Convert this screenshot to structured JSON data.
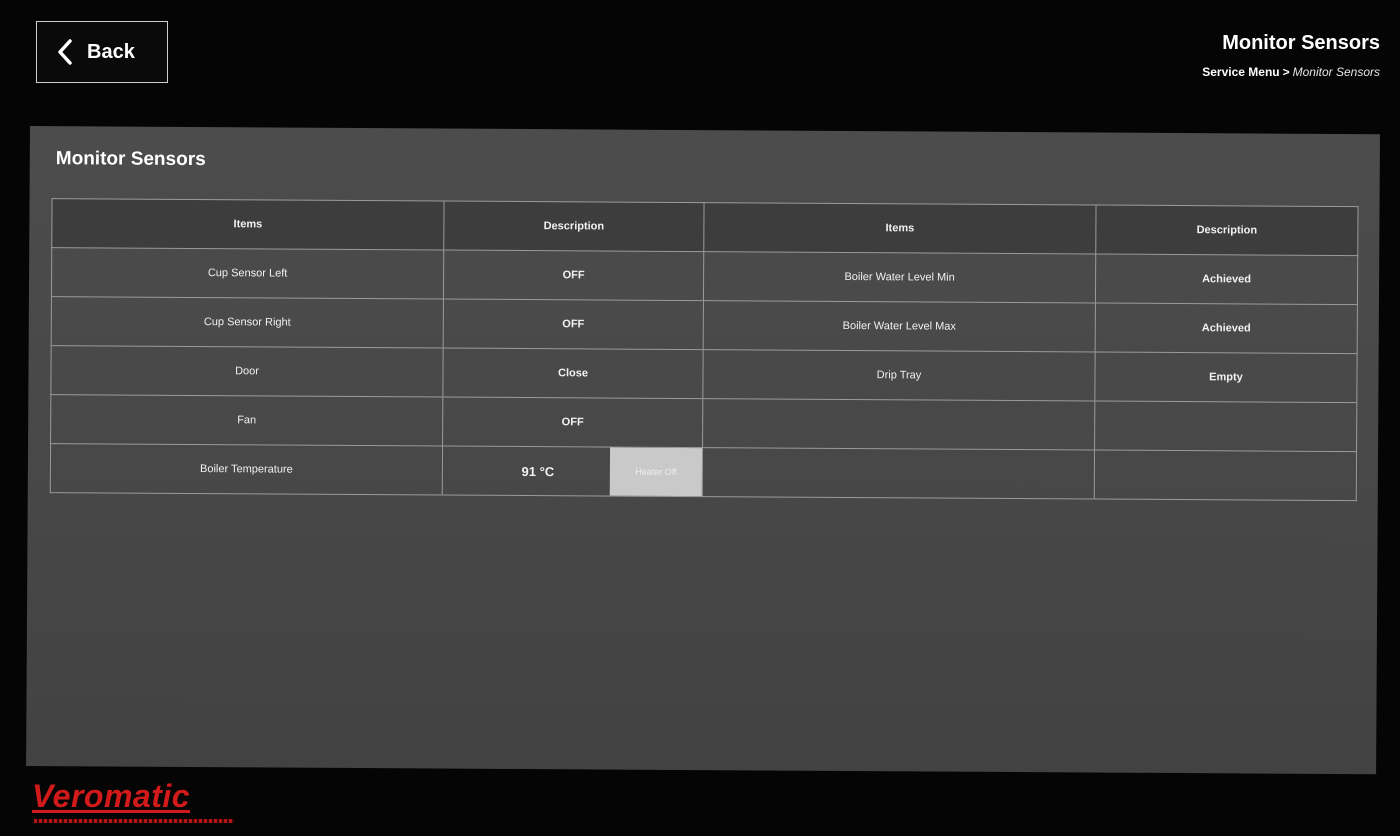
{
  "header": {
    "back_label": "Back",
    "title": "Monitor Sensors",
    "breadcrumb": {
      "parent": "Service Menu",
      "separator": ">",
      "current": "Monitor Sensors"
    }
  },
  "panel": {
    "title": "Monitor Sensors",
    "columns": [
      "Items",
      "Description",
      "Items",
      "Description"
    ],
    "left_rows": [
      {
        "item": "Cup Sensor Left",
        "value": "OFF"
      },
      {
        "item": "Cup Sensor Right",
        "value": "OFF"
      },
      {
        "item": "Door",
        "value": "Close"
      },
      {
        "item": "Fan",
        "value": "OFF"
      }
    ],
    "right_rows": [
      {
        "item": "Boiler Water Level Min",
        "value": "Achieved"
      },
      {
        "item": "Boiler Water Level Max",
        "value": "Achieved"
      },
      {
        "item": "Drip Tray",
        "value": "Empty"
      },
      {
        "item": "",
        "value": ""
      }
    ],
    "boiler": {
      "item": "Boiler Temperature",
      "value": "91 °C",
      "heater_label": "Heater Off"
    }
  },
  "brand": {
    "logo": "Veromatic",
    "color": "#d21a1a"
  },
  "icons": {
    "back": "chevron-left-icon"
  }
}
